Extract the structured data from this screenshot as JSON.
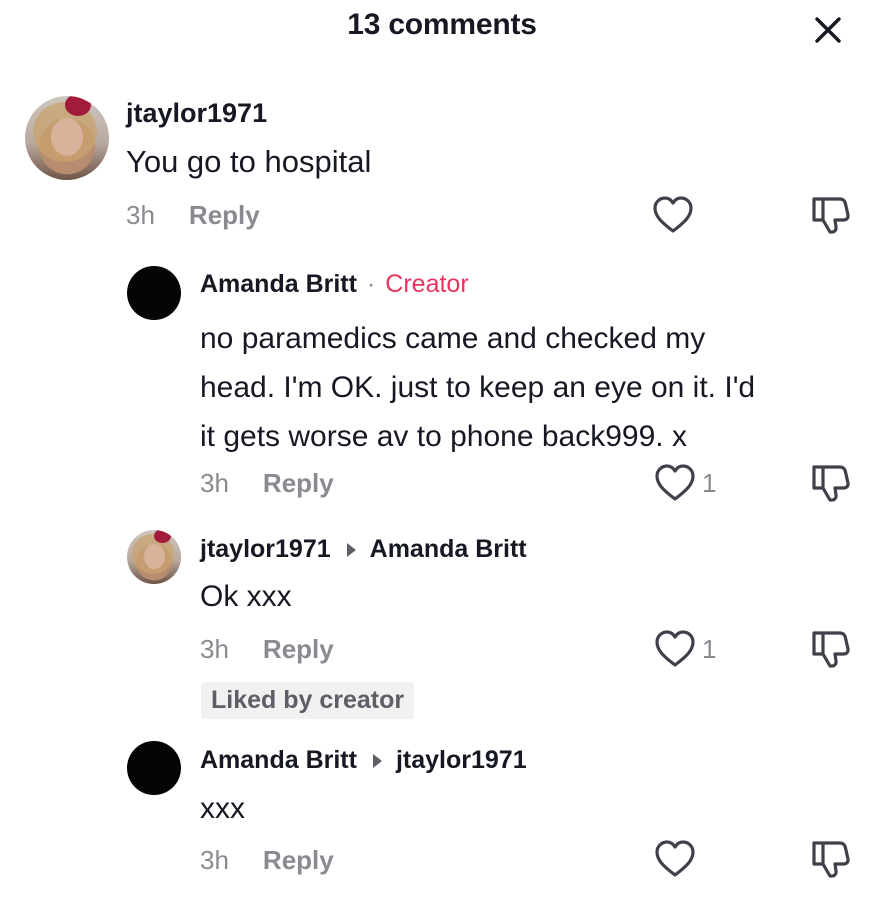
{
  "header": {
    "title": "13 comments",
    "close_icon": "close-icon"
  },
  "comments": [
    {
      "username": "jtaylor1971",
      "text": "You go to hospital",
      "time": "3h",
      "reply_label": "Reply",
      "like_count": "",
      "avatar": "photo"
    },
    {
      "username": "Amanda Britt",
      "separator": "·",
      "creator_label": "Creator",
      "text_lines": [
        "no paramedics came and checked my",
        "head. I'm OK. just to keep an eye on it. I'd",
        "it gets worse av to phone back999. x"
      ],
      "time": "3h",
      "reply_label": "Reply",
      "like_count": "1",
      "avatar": "dark"
    },
    {
      "username": "jtaylor1971",
      "reply_to": "Amanda Britt",
      "text": "Ok xxx",
      "time": "3h",
      "reply_label": "Reply",
      "like_count": "1",
      "liked_badge": "Liked by creator",
      "avatar": "photo"
    },
    {
      "username": "Amanda Britt",
      "reply_to": "jtaylor1971",
      "text": "xxx",
      "time": "3h",
      "reply_label": "Reply",
      "like_count": "",
      "avatar": "dark"
    }
  ],
  "colors": {
    "creator": "#e8345e",
    "meta": "#8a8b91",
    "text": "#161823"
  }
}
